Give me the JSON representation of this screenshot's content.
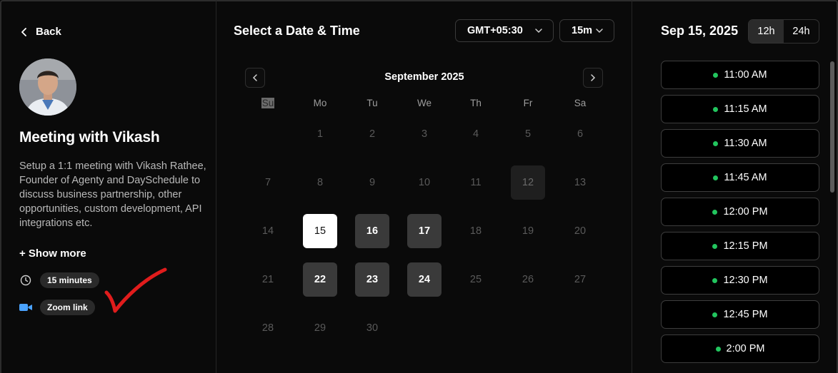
{
  "left": {
    "back_label": "Back",
    "title": "Meeting with Vikash",
    "description": "Setup a 1:1 meeting with Vikash Rathee, Founder of Agenty and DaySchedule to discuss business partnership, other opportunities, custom development, API integrations etc.",
    "show_more": "+ Show more",
    "duration": "15 minutes",
    "location": "Zoom link"
  },
  "calendar": {
    "heading": "Select a Date & Time",
    "timezone": "GMT+05:30",
    "duration": "15m",
    "month": "September 2025",
    "weekdays": [
      "Su",
      "Mo",
      "Tu",
      "We",
      "Th",
      "Fr",
      "Sa"
    ],
    "weeks": [
      [
        {
          "d": ""
        },
        {
          "d": "1"
        },
        {
          "d": "2"
        },
        {
          "d": "3"
        },
        {
          "d": "4"
        },
        {
          "d": "5"
        },
        {
          "d": "6"
        }
      ],
      [
        {
          "d": "7"
        },
        {
          "d": "8"
        },
        {
          "d": "9"
        },
        {
          "d": "10"
        },
        {
          "d": "11"
        },
        {
          "d": "12",
          "s": "today"
        },
        {
          "d": "13"
        }
      ],
      [
        {
          "d": "14"
        },
        {
          "d": "15",
          "s": "selected"
        },
        {
          "d": "16",
          "s": "available"
        },
        {
          "d": "17",
          "s": "available"
        },
        {
          "d": "18"
        },
        {
          "d": "19"
        },
        {
          "d": "20"
        }
      ],
      [
        {
          "d": "21"
        },
        {
          "d": "22",
          "s": "available"
        },
        {
          "d": "23",
          "s": "available"
        },
        {
          "d": "24",
          "s": "available"
        },
        {
          "d": "25"
        },
        {
          "d": "26"
        },
        {
          "d": "27"
        }
      ],
      [
        {
          "d": "28"
        },
        {
          "d": "29"
        },
        {
          "d": "30"
        },
        {
          "d": ""
        },
        {
          "d": ""
        },
        {
          "d": ""
        },
        {
          "d": ""
        }
      ]
    ]
  },
  "slots": {
    "date_heading": "Sep 15, 2025",
    "format_12h": "12h",
    "format_24h": "24h",
    "active_format": "12h",
    "times": [
      "11:00 AM",
      "11:15 AM",
      "11:30 AM",
      "11:45 AM",
      "12:00 PM",
      "12:15 PM",
      "12:30 PM",
      "12:45 PM",
      "2:00 PM"
    ],
    "status_color": "#22c55e"
  }
}
